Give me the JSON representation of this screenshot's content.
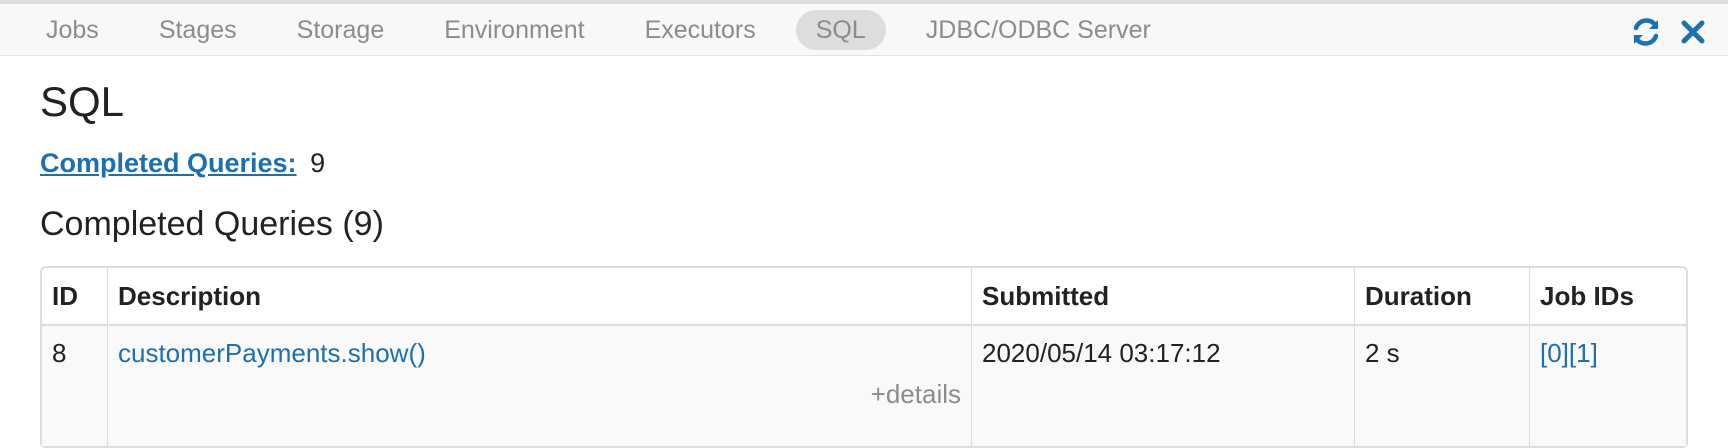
{
  "nav": {
    "tabs": [
      {
        "label": "Jobs"
      },
      {
        "label": "Stages"
      },
      {
        "label": "Storage"
      },
      {
        "label": "Environment"
      },
      {
        "label": "Executors"
      },
      {
        "label": "SQL"
      },
      {
        "label": "JDBC/ODBC Server"
      }
    ],
    "active_tab": "SQL",
    "icons": [
      "refresh-icon",
      "close-icon"
    ],
    "icon_color": "#1d6fb0"
  },
  "page": {
    "title": "SQL",
    "summary_label": "Completed Queries:",
    "summary_count": "9",
    "section_title": "Completed Queries (9)"
  },
  "table": {
    "columns": [
      "ID",
      "Description",
      "Submitted",
      "Duration",
      "Job IDs"
    ],
    "rows": [
      {
        "id": "8",
        "description": "customerPayments.show()",
        "details_toggle": "+details",
        "submitted": "2020/05/14 03:17:12",
        "duration": "2 s",
        "job_ids": [
          "[0]",
          "[1]"
        ]
      }
    ]
  },
  "colors": {
    "link": "#1d6fb0",
    "tab_active_bg": "#dddddd",
    "muted_text": "#8c8c8c"
  }
}
